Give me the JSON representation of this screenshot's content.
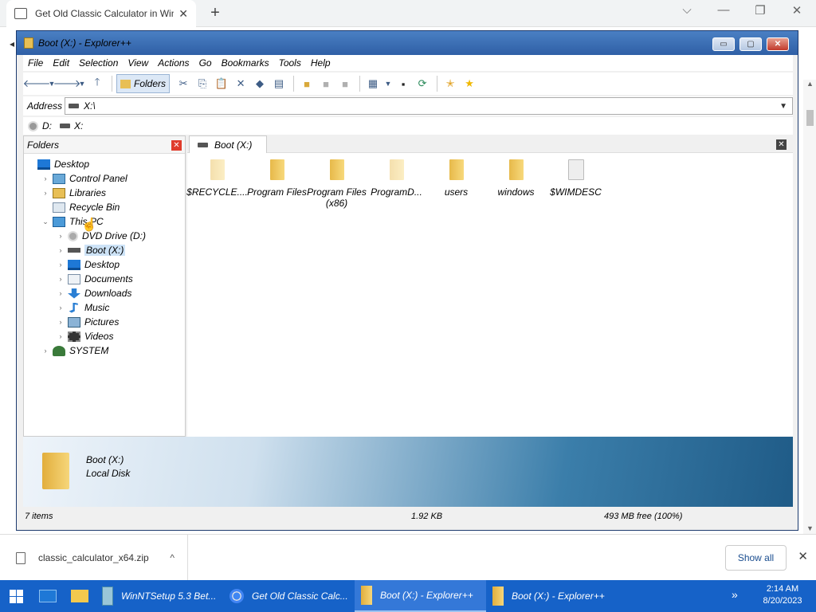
{
  "browser": {
    "tab_title": "Get Old Classic Calculator in Wind",
    "new_tab_symbol": "+",
    "tab_close_symbol": "✕",
    "minimize_symbol": "⌵",
    "maximize_symbol": "—",
    "restore_symbol": "❐",
    "close_symbol": "✕"
  },
  "explorer": {
    "window_title": "Boot (X:) - Explorer++",
    "title_buttons": {
      "minimize": "▭",
      "maximize": "▢",
      "close": "✕"
    },
    "menu": [
      "File",
      "Edit",
      "Selection",
      "View",
      "Actions",
      "Go",
      "Bookmarks",
      "Tools",
      "Help"
    ],
    "toolbar": {
      "folders_label": "Folders",
      "icons": [
        "back-arrow-icon",
        "back-dropdown-icon",
        "forward-arrow-icon",
        "forward-dropdown-icon",
        "up-arrow-icon",
        "cut-icon",
        "copy-icon",
        "paste-icon",
        "delete-icon",
        "delete-permanently-icon",
        "properties-icon",
        "new-folder-icon",
        "copy-to-icon",
        "move-to-icon",
        "views-icon",
        "views-dropdown-icon",
        "command-prompt-icon",
        "refresh-icon",
        "add-bookmark-icon",
        "bookmarks-icon"
      ]
    },
    "address": {
      "label": "Address",
      "value": "X:\\"
    },
    "drives": [
      {
        "label": "D:",
        "icon": "dvd-drive-icon"
      },
      {
        "label": "X:",
        "icon": "disk-drive-icon"
      }
    ],
    "folders_pane": {
      "header": "Folders",
      "items": [
        {
          "label": "Desktop",
          "level": 0,
          "expander": "",
          "icon": "desktop-icon"
        },
        {
          "label": "Control Panel",
          "level": 1,
          "expander": "›",
          "icon": "control-panel-icon"
        },
        {
          "label": "Libraries",
          "level": 1,
          "expander": "›",
          "icon": "libraries-icon"
        },
        {
          "label": "Recycle Bin",
          "level": 1,
          "expander": "",
          "icon": "recycle-bin-icon"
        },
        {
          "label": "This PC",
          "level": 1,
          "expander": "⌄",
          "icon": "this-pc-icon"
        },
        {
          "label": "DVD Drive (D:)",
          "level": 2,
          "expander": "›",
          "icon": "dvd-drive-icon"
        },
        {
          "label": "Boot (X:)",
          "level": 2,
          "expander": "›",
          "icon": "disk-drive-icon",
          "selected": true
        },
        {
          "label": "Desktop",
          "level": 2,
          "expander": "›",
          "icon": "desktop-icon"
        },
        {
          "label": "Documents",
          "level": 2,
          "expander": "›",
          "icon": "documents-icon"
        },
        {
          "label": "Downloads",
          "level": 2,
          "expander": "›",
          "icon": "downloads-icon"
        },
        {
          "label": "Music",
          "level": 2,
          "expander": "›",
          "icon": "music-icon"
        },
        {
          "label": "Pictures",
          "level": 2,
          "expander": "›",
          "icon": "pictures-icon"
        },
        {
          "label": "Videos",
          "level": 2,
          "expander": "›",
          "icon": "videos-icon"
        },
        {
          "label": "SYSTEM",
          "level": 1,
          "expander": "›",
          "icon": "user-icon"
        }
      ]
    },
    "file_tab": "Boot (X:)",
    "files": [
      {
        "name": "$RECYCLE....",
        "type": "folder",
        "hidden": true
      },
      {
        "name": "Program Files",
        "type": "folder",
        "hidden": false
      },
      {
        "name": "Program Files (x86)",
        "type": "folder",
        "hidden": false
      },
      {
        "name": "ProgramD...",
        "type": "folder",
        "hidden": true
      },
      {
        "name": "users",
        "type": "folder",
        "hidden": false
      },
      {
        "name": "windows",
        "type": "folder",
        "hidden": false
      },
      {
        "name": "$WIMDESC",
        "type": "file",
        "hidden": false
      }
    ],
    "info": {
      "name": "Boot (X:)",
      "type": "Local Disk"
    },
    "status": {
      "items": "7 items",
      "size": "1.92 KB",
      "free": "493 MB free (100%)"
    }
  },
  "downloads_bar": {
    "filename": "classic_calculator_x64.zip",
    "chevron": "^",
    "show_all": "Show all",
    "close": "✕"
  },
  "taskbar": {
    "tasks": [
      {
        "label": "WinNTSetup 5.3 Bet...",
        "icon": "winntsetup-icon"
      },
      {
        "label": "Get Old Classic Calc...",
        "icon": "chrome-icon"
      },
      {
        "label": "Boot (X:) - Explorer++",
        "icon": "explorer-plus-icon",
        "active": true
      },
      {
        "label": "Boot (X:) - Explorer++",
        "icon": "explorer-plus-icon"
      }
    ],
    "time": "2:14 AM",
    "date": "8/20/2023"
  },
  "colors": {
    "accent": "#1662c8",
    "title_bar": "#2f5fa6",
    "folder": "#e7b94a"
  }
}
